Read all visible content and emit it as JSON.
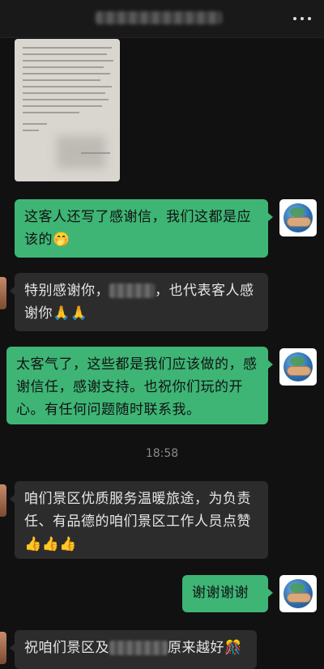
{
  "header": {
    "title_redacted": true,
    "more_icon": "more-dots-icon"
  },
  "messages": [
    {
      "side": "in",
      "type": "image",
      "content": "handwritten-letter-photo"
    },
    {
      "side": "out",
      "parts": [
        "这客人还写了感谢信，我们这都是应该的",
        "🤭"
      ]
    },
    {
      "side": "in",
      "parts": [
        "特别感谢你，",
        "，也代表客人感谢你",
        "🙏🙏"
      ]
    },
    {
      "side": "out",
      "parts": [
        "太客气了，这些都是我们应该做的，感谢信任，感谢支持。也祝你们玩的开心。有任何问题随时联系我。"
      ]
    },
    {
      "side": "in",
      "parts": [
        "咱们景区优质服务温暖旅途，为负责任、有品德的咱们景区工作人员点赞",
        "👍👍👍"
      ]
    },
    {
      "side": "out",
      "parts": [
        "谢谢谢谢"
      ]
    },
    {
      "side": "in",
      "parts": [
        "祝咱们景区及",
        "原来越好",
        "🎊"
      ]
    }
  ],
  "timestamp": "18:58",
  "colors": {
    "outgoing_bubble": "#3eb575",
    "incoming_bubble": "#2c2c2c",
    "background": "#111111"
  }
}
